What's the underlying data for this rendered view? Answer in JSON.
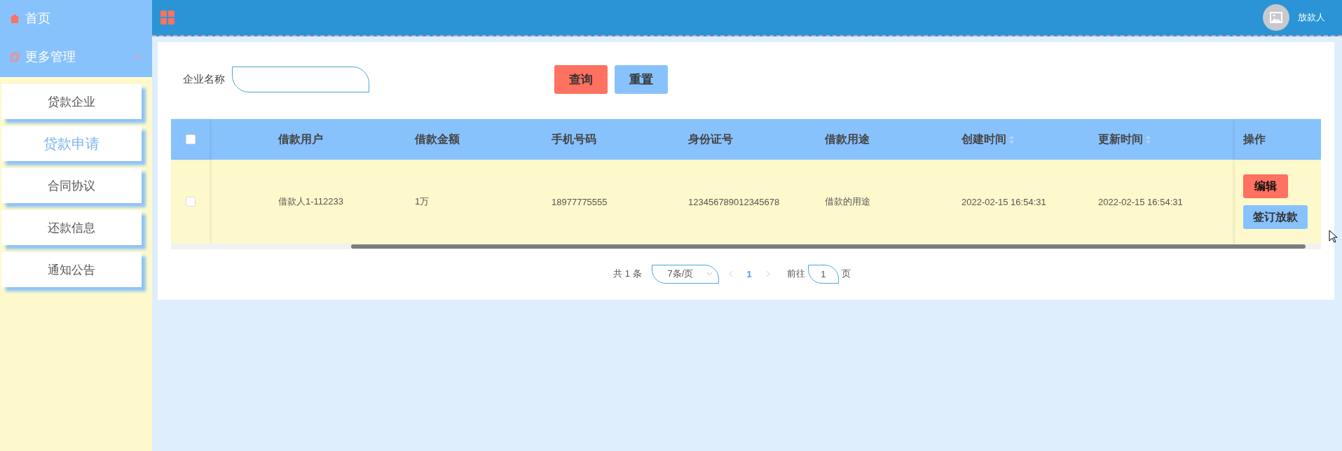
{
  "sidebar": {
    "home": {
      "label": "首页"
    },
    "menu": {
      "label": "更多管理",
      "expanded": true
    },
    "items": [
      {
        "label": "贷款企业",
        "selected": false
      },
      {
        "label": "贷款申请",
        "selected": true
      },
      {
        "label": "合同协议",
        "selected": false
      },
      {
        "label": "还款信息",
        "selected": false
      },
      {
        "label": "通知公告",
        "selected": false
      }
    ]
  },
  "header": {
    "username": "放款人"
  },
  "search": {
    "label": "企业名称",
    "buttons": [
      {
        "label": "查询",
        "kind": "primary"
      },
      {
        "label": "重置",
        "kind": "secondary"
      }
    ]
  },
  "table": {
    "select_all": {
      "checked": false
    },
    "columns": [
      {
        "label": "借款用户",
        "sortable": false
      },
      {
        "label": "借款金额",
        "sortable": false
      },
      {
        "label": "手机号码",
        "sortable": false
      },
      {
        "label": "身份证号",
        "sortable": false
      },
      {
        "label": "借款用途",
        "sortable": false
      },
      {
        "label": "创建时间",
        "sortable": true
      },
      {
        "label": "更新时间",
        "sortable": true
      }
    ],
    "actions_label": "操作",
    "rows": [
      {
        "checked": false,
        "cells": [
          "借款人1-112233",
          "1万",
          "18977775555",
          "123456789012345678",
          "借款的用途",
          "2022-02-15 16:54:31",
          "2022-02-15 16:54:31"
        ],
        "actions": [
          {
            "label": "编辑",
            "kind": "danger"
          },
          {
            "label": "签订放款",
            "kind": "secondary"
          }
        ]
      }
    ]
  },
  "pagination": {
    "total": "共 1 条",
    "page_size": "7条/页",
    "pages": [
      {
        "label": "1",
        "selected": true
      }
    ],
    "goto_label": "前往",
    "goto_value": "1",
    "goto_suffix": "页"
  }
}
